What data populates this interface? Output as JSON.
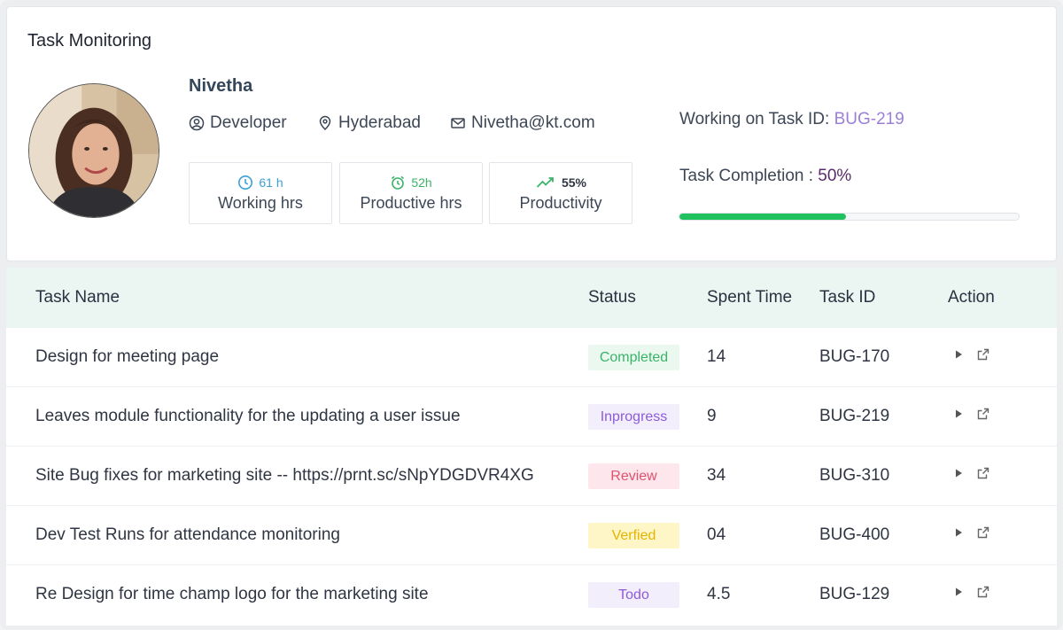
{
  "card": {
    "title": "Task Monitoring",
    "user": {
      "name": "Nivetha",
      "role": "Developer",
      "location": "Hyderabad",
      "email": "Nivetha@kt.com"
    },
    "stats": [
      {
        "value": "61 h",
        "label": "Working hrs",
        "icon": "clock-icon",
        "color": "#3aa0d8"
      },
      {
        "value": "52h",
        "label": "Productive hrs",
        "icon": "alarm-clock-icon",
        "color": "#3bb36a"
      },
      {
        "value": "55%",
        "label": "Productivity",
        "icon": "trending-up-icon",
        "color": "#2f3542"
      }
    ],
    "working_label": "Working on Task ID: ",
    "working_task_id": "BUG-219",
    "completion_label": "Task Completion : ",
    "completion_value": "50%",
    "completion_fraction": 0.49,
    "progress_color": "#1fc25e"
  },
  "table": {
    "headers": {
      "name": "Task Name",
      "status": "Status",
      "time": "Spent Time",
      "id": "Task ID",
      "action": "Action"
    },
    "rows": [
      {
        "name": "Design for meeting page",
        "status": "Completed",
        "status_fg": "#3bb36a",
        "status_bg": "#eaf8ef",
        "time": "14",
        "id": "BUG-170"
      },
      {
        "name": "Leaves module functionality for the updating a user issue",
        "status": "Inprogress",
        "status_fg": "#8e5bd8",
        "status_bg": "#f3eefb",
        "time": "9",
        "id": "BUG-219"
      },
      {
        "name": "Site Bug fixes for marketing site -- https://prnt.sc/sNpYDGDVR4XG",
        "status": "Review",
        "status_fg": "#e0516e",
        "status_bg": "#fde7ec",
        "time": "34",
        "id": "BUG-310"
      },
      {
        "name": "Dev Test Runs for attendance monitoring",
        "status": "Verfied",
        "status_fg": "#e4b400",
        "status_bg": "#fff6c8",
        "time": "04",
        "id": "BUG-400"
      },
      {
        "name": "Re Design for time champ logo for the marketing site",
        "status": "Todo",
        "status_fg": "#8e5bd8",
        "status_bg": "#f3eefb",
        "time": "4.5",
        "id": "BUG-129"
      }
    ]
  }
}
